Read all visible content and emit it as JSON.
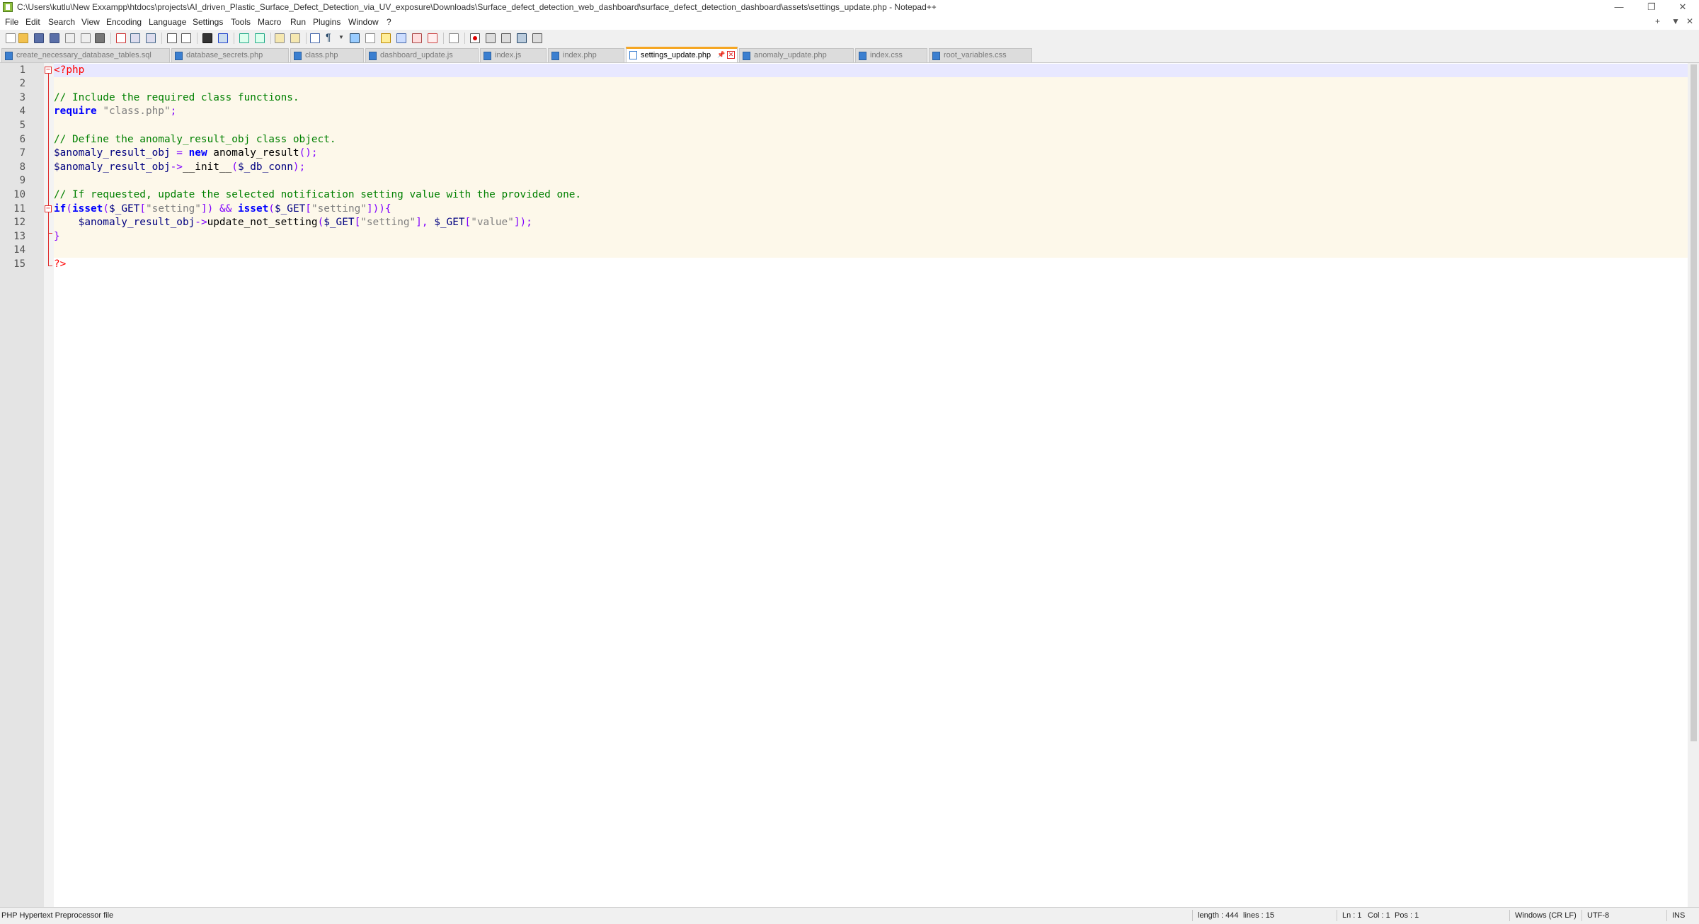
{
  "window": {
    "title": "C:\\Users\\kutlu\\New Exxampp\\htdocs\\projects\\AI_driven_Plastic_Surface_Defect_Detection_via_UV_exposure\\Downloads\\Surface_defect_detection_web_dashboard\\surface_defect_detection_dashboard\\assets\\settings_update.php - Notepad++",
    "minimize": "—",
    "restore": "❐",
    "close": "✕"
  },
  "menu": {
    "items": [
      "File",
      "Edit",
      "Search",
      "View",
      "Encoding",
      "Language",
      "Settings",
      "Tools",
      "Macro",
      "Run",
      "Plugins",
      "Window",
      "?"
    ],
    "right": [
      "+",
      "▼",
      "✕"
    ]
  },
  "tabs": [
    {
      "label": "create_necessary_database_tables.sql"
    },
    {
      "label": "database_secrets.php"
    },
    {
      "label": "class.php"
    },
    {
      "label": "dashboard_update.js"
    },
    {
      "label": "index.js"
    },
    {
      "label": "index.php"
    },
    {
      "label": "settings_update.php",
      "active": true
    },
    {
      "label": "anomaly_update.php"
    },
    {
      "label": "index.css"
    },
    {
      "label": "root_variables.css"
    }
  ],
  "tab_icons": {
    "pin": "📌",
    "close": "✕"
  },
  "editor": {
    "line_numbers": [
      "1",
      "2",
      "3",
      "4",
      "5",
      "6",
      "7",
      "8",
      "9",
      "10",
      "11",
      "12",
      "13",
      "14",
      "15"
    ],
    "lines": [
      [
        {
          "t": "<?php",
          "c": "php"
        }
      ],
      [],
      [
        {
          "t": "// Include the required class functions.",
          "c": "cmt"
        }
      ],
      [
        {
          "t": "require",
          "c": "kw"
        },
        {
          "t": " ",
          "c": "txt"
        },
        {
          "t": "\"class.php\"",
          "c": "str"
        },
        {
          "t": ";",
          "c": "op"
        }
      ],
      [],
      [
        {
          "t": "// Define the anomaly_result_obj class object.",
          "c": "cmt"
        }
      ],
      [
        {
          "t": "$anomaly_result_obj",
          "c": "var"
        },
        {
          "t": " = ",
          "c": "op"
        },
        {
          "t": "new",
          "c": "kw"
        },
        {
          "t": " anomaly_result",
          "c": "txt"
        },
        {
          "t": "();",
          "c": "op"
        }
      ],
      [
        {
          "t": "$anomaly_result_obj",
          "c": "var"
        },
        {
          "t": "->",
          "c": "op"
        },
        {
          "t": "__init__",
          "c": "txt"
        },
        {
          "t": "(",
          "c": "op"
        },
        {
          "t": "$_db_conn",
          "c": "var"
        },
        {
          "t": ");",
          "c": "op"
        }
      ],
      [],
      [
        {
          "t": "// If requested, update the selected notification setting value with the provided one.",
          "c": "cmt"
        }
      ],
      [
        {
          "t": "if",
          "c": "kw"
        },
        {
          "t": "(",
          "c": "op"
        },
        {
          "t": "isset",
          "c": "kw"
        },
        {
          "t": "(",
          "c": "op"
        },
        {
          "t": "$_GET",
          "c": "var"
        },
        {
          "t": "[",
          "c": "op"
        },
        {
          "t": "\"setting\"",
          "c": "str"
        },
        {
          "t": "]) && ",
          "c": "op"
        },
        {
          "t": "isset",
          "c": "kw"
        },
        {
          "t": "(",
          "c": "op"
        },
        {
          "t": "$_GET",
          "c": "var"
        },
        {
          "t": "[",
          "c": "op"
        },
        {
          "t": "\"setting\"",
          "c": "str"
        },
        {
          "t": "])){",
          "c": "op"
        }
      ],
      [
        {
          "t": "    ",
          "c": "txt"
        },
        {
          "t": "$anomaly_result_obj",
          "c": "var"
        },
        {
          "t": "->",
          "c": "op"
        },
        {
          "t": "update_not_setting",
          "c": "txt"
        },
        {
          "t": "(",
          "c": "op"
        },
        {
          "t": "$_GET",
          "c": "var"
        },
        {
          "t": "[",
          "c": "op"
        },
        {
          "t": "\"setting\"",
          "c": "str"
        },
        {
          "t": "], ",
          "c": "op"
        },
        {
          "t": "$_GET",
          "c": "var"
        },
        {
          "t": "[",
          "c": "op"
        },
        {
          "t": "\"value\"",
          "c": "str"
        },
        {
          "t": "]);",
          "c": "op"
        }
      ],
      [
        {
          "t": "}",
          "c": "op"
        }
      ],
      [],
      [
        {
          "t": "?>",
          "c": "php"
        }
      ]
    ]
  },
  "status": {
    "file_type": "PHP Hypertext Preprocessor file",
    "length": "length : 444",
    "lines": "lines : 15",
    "ln": "Ln : 1",
    "col": "Col : 1",
    "pos": "Pos : 1",
    "eol": "Windows (CR LF)",
    "encoding": "UTF-8",
    "mode": "INS"
  },
  "colors": {
    "comment": "#008000",
    "keyword": "#0000ff",
    "variable": "#000080",
    "operator": "#8000ff",
    "string": "#808080",
    "php_tag": "#ff0000",
    "active_tab_accent": "#f5a623",
    "block_highlight": "#fdf8ea",
    "caret_line": "#e8e8ff"
  }
}
